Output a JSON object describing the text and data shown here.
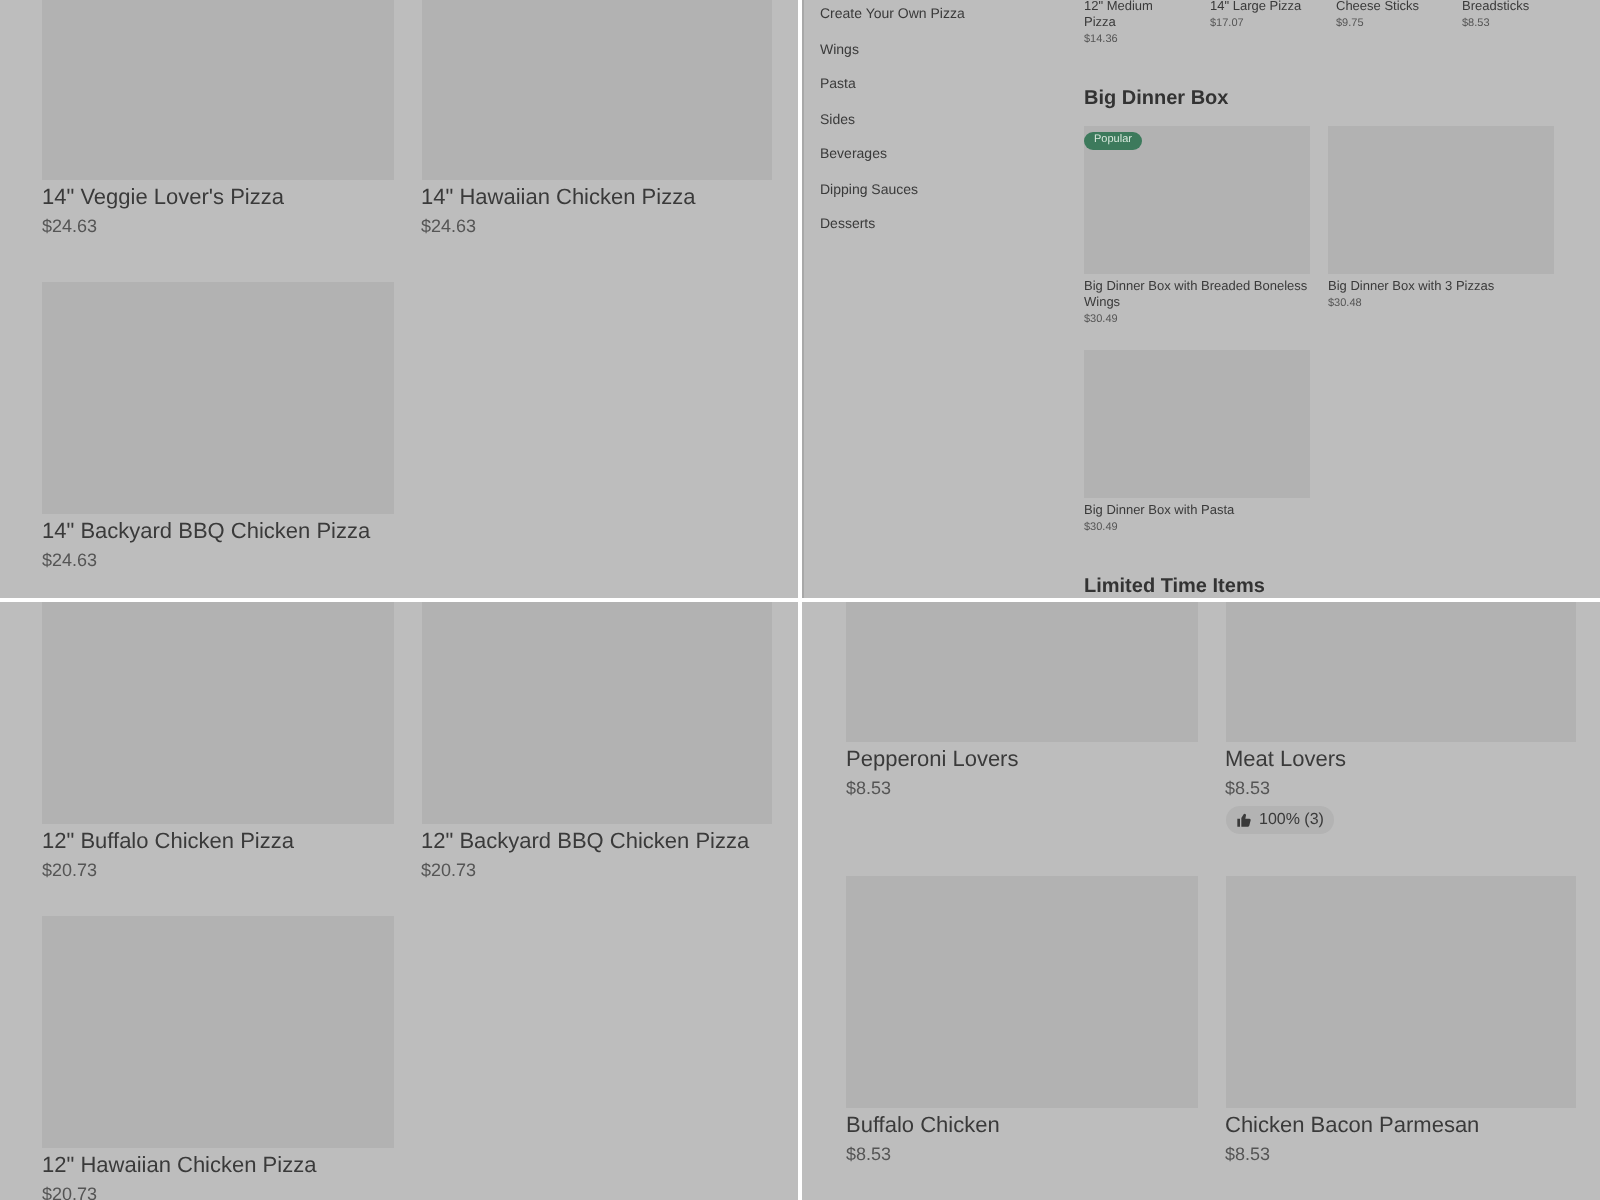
{
  "panels": [
    {
      "kind": "grid",
      "cards": [
        {
          "name": "14\" Veggie Lover's Pizza",
          "price": "$24.63"
        },
        {
          "name": "14\" Hawaiian Chicken Pizza",
          "price": "$24.63"
        },
        {
          "name": "14\" Backyard BBQ Chicken Pizza",
          "price": "$24.63"
        }
      ]
    },
    {
      "kind": "menu",
      "sidebar": {
        "items": [
          "Create Your Own Pizza",
          "Wings",
          "Pasta",
          "Sides",
          "Beverages",
          "Dipping Sauces",
          "Desserts"
        ]
      },
      "top_items": [
        {
          "name": "12\" Medium Pizza",
          "price": "$14.36"
        },
        {
          "name": "14\" Large Pizza",
          "price": "$17.07"
        },
        {
          "name": "Cheese Sticks",
          "price": "$9.75"
        },
        {
          "name": "Breadsticks",
          "price": "$8.53"
        }
      ],
      "section": {
        "title": "Big Dinner Box",
        "cards": [
          {
            "name": "Big Dinner Box with Breaded Boneless Wings",
            "price": "$30.49",
            "badge": "Popular"
          },
          {
            "name": "Big Dinner Box with 3 Pizzas",
            "price": "$30.48"
          },
          {
            "name": "Big Dinner Box with Pasta",
            "price": "$30.49"
          }
        ]
      },
      "next_section_title": "Limited Time Items"
    },
    {
      "kind": "grid",
      "cards": [
        {
          "name": "12\" Buffalo Chicken Pizza",
          "price": "$20.73"
        },
        {
          "name": "12\" Backyard BBQ Chicken Pizza",
          "price": "$20.73"
        },
        {
          "name": "12\" Hawaiian Chicken Pizza",
          "price": "$20.73"
        }
      ]
    },
    {
      "kind": "grid",
      "cards": [
        {
          "name": "Pepperoni Lovers",
          "price": "$8.53"
        },
        {
          "name": "Meat Lovers",
          "price": "$8.53",
          "rating": "100% (3)"
        },
        {
          "name": "Buffalo Chicken",
          "price": "$8.53"
        },
        {
          "name": "Chicken Bacon Parmesan",
          "price": "$8.53"
        }
      ]
    }
  ]
}
